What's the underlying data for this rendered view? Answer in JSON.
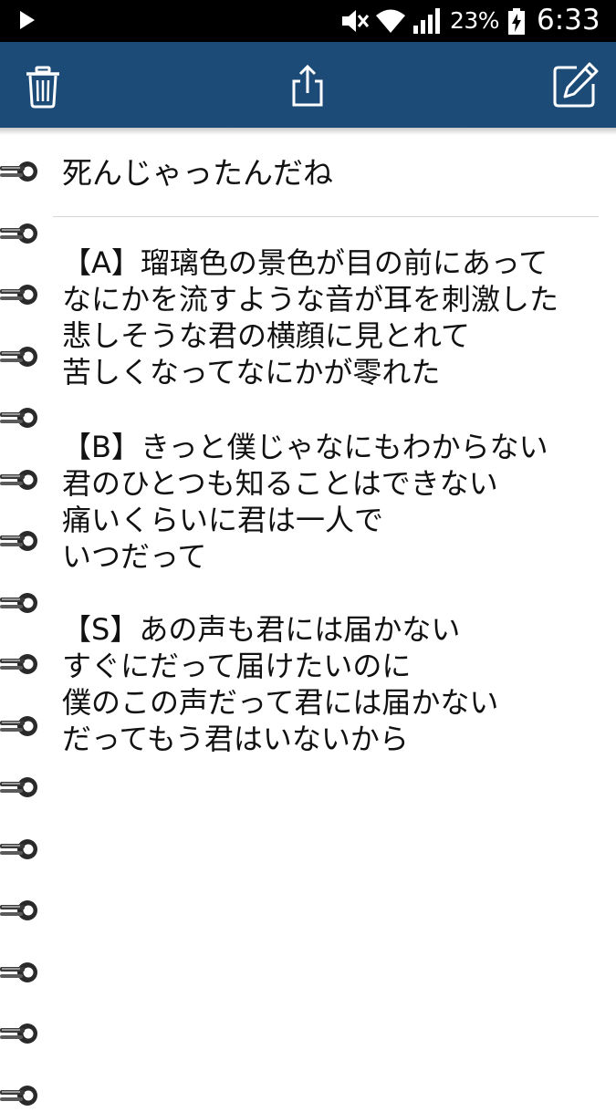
{
  "status_bar": {
    "battery_percent": "23%",
    "clock": "6:33",
    "icons": [
      "play-icon",
      "mute-icon",
      "wifi-icon",
      "signal-icon",
      "battery-charging-icon"
    ]
  },
  "toolbar": {
    "background": "#1d4b77",
    "buttons": [
      "trash-icon",
      "share-icon",
      "edit-icon"
    ]
  },
  "note": {
    "title": "死んじゃったんだね",
    "stanzas": [
      {
        "lines": [
          "【A】瑠璃色の景色が目の前にあって",
          "なにかを流すような音が耳を刺激した",
          "悲しそうな君の横顔に見とれて",
          "苦しくなってなにかが零れた"
        ]
      },
      {
        "lines": [
          "【B】きっと僕じゃなにもわからない",
          "君のひとつも知ることはできない",
          "痛いくらいに君は一人で",
          "いつだって"
        ]
      },
      {
        "lines": [
          "【S】あの声も君には届かない",
          "すぐにだって届けたいのに",
          "僕のこの声だって君には届かない",
          "だってもう君はいないから"
        ]
      }
    ]
  }
}
